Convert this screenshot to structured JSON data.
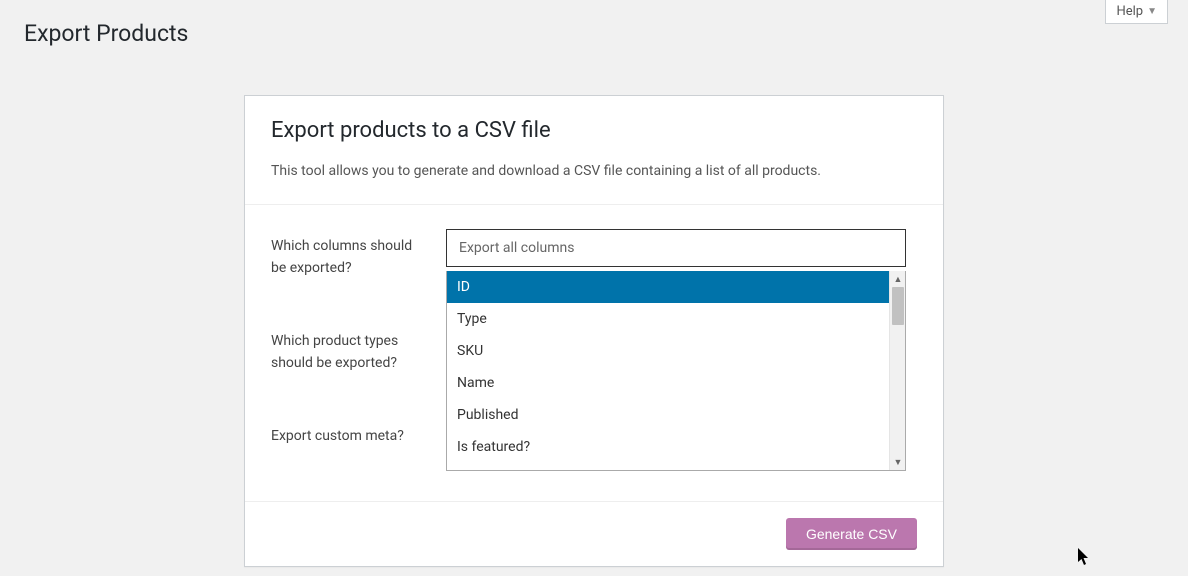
{
  "header": {
    "help_label": "Help",
    "page_title": "Export Products"
  },
  "panel": {
    "title": "Export products to a CSV file",
    "description": "This tool allows you to generate and download a CSV file containing a list of all products."
  },
  "form": {
    "columns_label": "Which columns should be exported?",
    "columns_placeholder": "Export all columns",
    "types_label": "Which product types should be exported?",
    "meta_label": "Export custom meta?"
  },
  "dropdown": {
    "options": [
      "ID",
      "Type",
      "SKU",
      "Name",
      "Published",
      "Is featured?"
    ]
  },
  "actions": {
    "generate_label": "Generate CSV"
  }
}
